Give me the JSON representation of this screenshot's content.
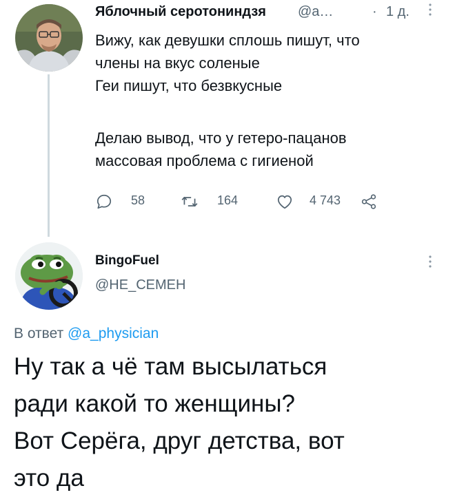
{
  "tweet1": {
    "display_name": "Яблочный серотониндзя",
    "handle": "@a…",
    "separator": "·",
    "time": "1 д.",
    "text_lines": [
      "Вижу, как девушки сплошь пишут, что",
      "члены на вкус соленые",
      "Геи пишут, что безвкусные"
    ],
    "text_lines_2": [
      "Делаю вывод, что у гетеро-пацанов",
      "массовая проблема с гигиеной"
    ],
    "actions": {
      "replies": "58",
      "retweets": "164",
      "likes": "4 743"
    },
    "icons": [
      "reply-icon",
      "retweet-icon",
      "like-icon",
      "share-icon",
      "more-icon"
    ]
  },
  "tweet2": {
    "display_name": "BingoFuel",
    "handle": "@НЕ_СЕМЕН",
    "reply_prefix": "В ответ",
    "reply_mention": "@a_physician",
    "text_lines": [
      "Ну так а чё там высылаться",
      "ради какой то женщины?",
      "Вот Серёга, друг детства, вот",
      "это да"
    ]
  },
  "colors": {
    "text": "#0f1419",
    "secondary": "#536471",
    "accent": "#1d9bf0",
    "thread_line": "#cfd9de"
  }
}
